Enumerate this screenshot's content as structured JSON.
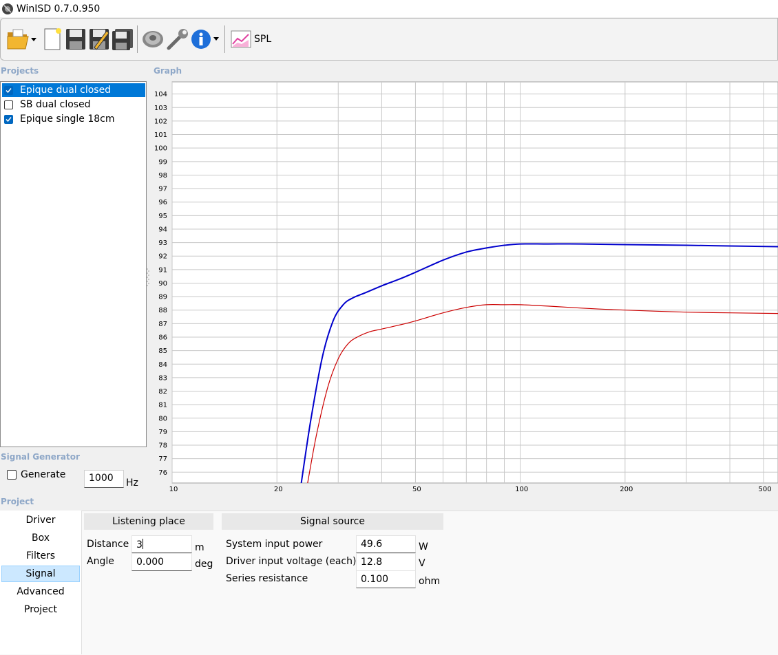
{
  "window": {
    "title": "WinISD 0.7.0.950"
  },
  "toolbar": {
    "icons": [
      "open-folder-icon",
      "new-project-icon",
      "save-icon",
      "save-as-icon",
      "save-all-icon",
      "driver-icon",
      "tools-icon",
      "info-icon",
      "spl-graph-icon"
    ],
    "graph_label": "SPL"
  },
  "sections": {
    "projects": "Projects",
    "graph": "Graph",
    "signal_generator": "Signal Generator",
    "project": "Project"
  },
  "projects": [
    {
      "name": "Epique dual closed",
      "checked": true,
      "selected": true
    },
    {
      "name": "SB dual closed",
      "checked": false,
      "selected": false
    },
    {
      "name": "Epique single 18cm",
      "checked": true,
      "selected": false
    }
  ],
  "signal_generator": {
    "generate_label": "Generate",
    "generate_checked": false,
    "frequency": "1000",
    "unit": "Hz"
  },
  "nav": {
    "items": [
      "Driver",
      "Box",
      "Filters",
      "Signal",
      "Advanced",
      "Project"
    ],
    "selected": "Signal"
  },
  "listening_place": {
    "header": "Listening place",
    "distance_label": "Distance",
    "distance_value": "3",
    "distance_unit": "m",
    "angle_label": "Angle",
    "angle_value": "0.000",
    "angle_unit": "deg"
  },
  "signal_source": {
    "header": "Signal source",
    "power_label": "System input power",
    "power_value": "49.6",
    "power_unit": "W",
    "voltage_label": "Driver input voltage (each)",
    "voltage_value": "12.8",
    "voltage_unit": "V",
    "resistance_label": "Series resistance",
    "resistance_value": "0.100",
    "resistance_unit": "ohm"
  },
  "chart_data": {
    "type": "line",
    "x_scale": "log",
    "xlim": [
      10,
      550
    ],
    "ylim": [
      75.2,
      104.9
    ],
    "x_ticks": [
      10,
      20,
      50,
      100,
      200,
      500
    ],
    "x_grid": [
      10,
      20,
      30,
      40,
      50,
      60,
      70,
      80,
      90,
      100,
      200,
      300,
      400,
      500
    ],
    "y_ticks": [
      76,
      77,
      78,
      79,
      80,
      81,
      82,
      83,
      84,
      85,
      86,
      87,
      88,
      89,
      90,
      91,
      92,
      93,
      94,
      95,
      96,
      97,
      98,
      99,
      100,
      101,
      102,
      103,
      104
    ],
    "grid": true,
    "colors": {
      "grid": "#c8c8c8",
      "background": "#ffffff"
    },
    "series": [
      {
        "color": "#0000cc",
        "x": [
          23.5,
          25,
          27,
          29,
          31,
          33,
          36,
          40,
          45,
          50,
          60,
          70,
          80,
          90,
          100,
          120,
          150,
          200,
          300,
          400,
          550
        ],
        "y": [
          75.2,
          79.8,
          84.5,
          87.2,
          88.4,
          88.9,
          89.3,
          89.8,
          90.3,
          90.8,
          91.7,
          92.3,
          92.6,
          92.8,
          92.9,
          92.9,
          92.9,
          92.85,
          92.8,
          92.75,
          92.7
        ]
      },
      {
        "color": "#cc0000",
        "x": [
          24.5,
          26,
          28,
          30,
          32,
          34,
          37,
          40,
          45,
          50,
          60,
          70,
          80,
          90,
          100,
          120,
          150,
          200,
          300,
          400,
          550
        ],
        "y": [
          75.2,
          78.8,
          82.3,
          84.4,
          85.5,
          86.0,
          86.4,
          86.6,
          86.9,
          87.2,
          87.8,
          88.2,
          88.4,
          88.4,
          88.4,
          88.3,
          88.15,
          88.0,
          87.85,
          87.8,
          87.75
        ]
      }
    ]
  }
}
